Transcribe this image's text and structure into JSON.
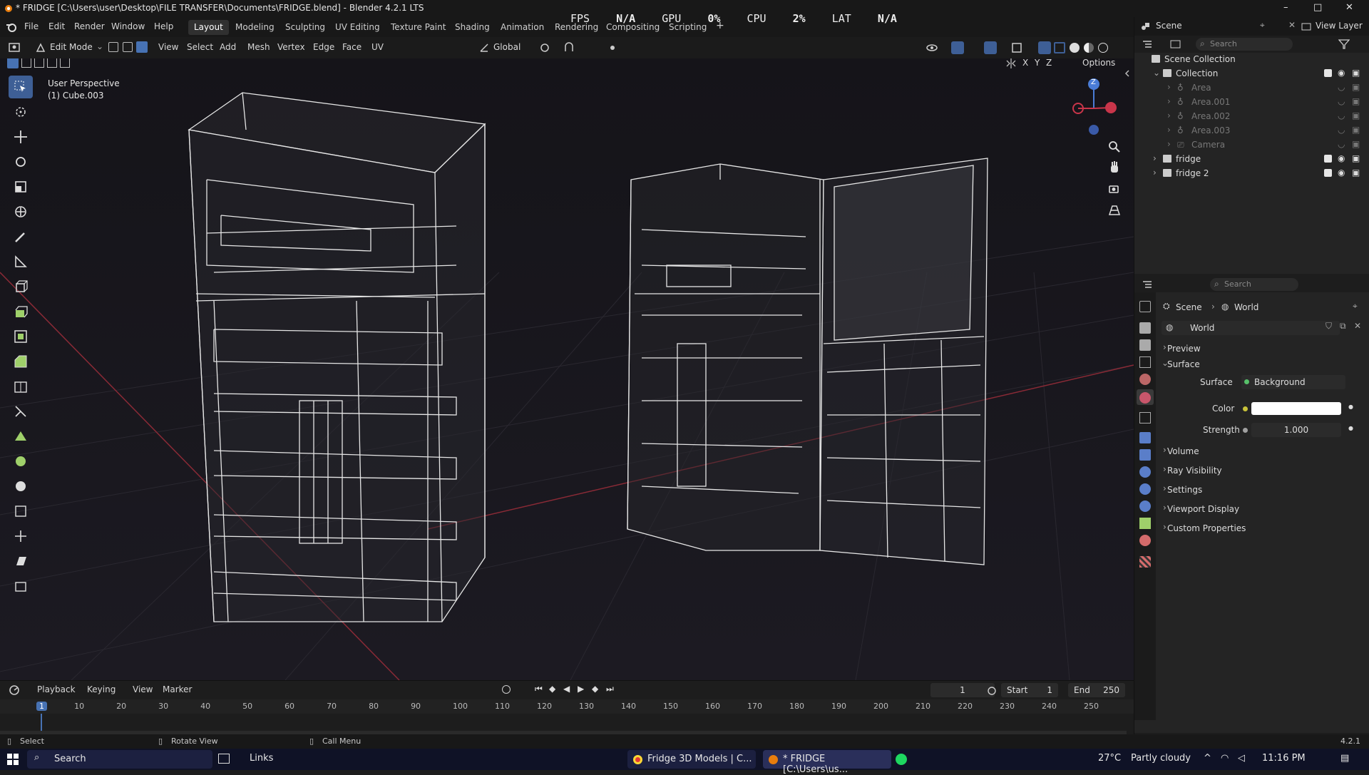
{
  "window": {
    "title": "* FRIDGE [C:\\Users\\user\\Desktop\\FILE TRANSFER\\Documents\\FRIDGE.blend] - Blender 4.2.1 LTS",
    "minimize": "–",
    "maximize": "□",
    "close": "✕"
  },
  "menus": [
    "File",
    "Edit",
    "Render",
    "Window",
    "Help"
  ],
  "workspaces": [
    {
      "label": "Layout",
      "active": true
    },
    {
      "label": "Modeling"
    },
    {
      "label": "Sculpting"
    },
    {
      "label": "UV Editing"
    },
    {
      "label": "Texture Paint"
    },
    {
      "label": "Shading"
    },
    {
      "label": "Animation"
    },
    {
      "label": "Rendering"
    },
    {
      "label": "Compositing"
    },
    {
      "label": "Scripting"
    }
  ],
  "add_workspace": "+",
  "stats": {
    "fps_label": "FPS",
    "fps": "N/A",
    "gpu_label": "GPU",
    "gpu": "0%",
    "cpu_label": "CPU",
    "cpu": "2%",
    "lat_label": "LAT",
    "lat": "N/A"
  },
  "scene_selector": {
    "label": "Scene",
    "view_layer": "View Layer"
  },
  "viewport_header": {
    "mode": "Edit Mode",
    "menus": [
      "View",
      "Select",
      "Add",
      "Mesh",
      "Vertex",
      "Edge",
      "Face",
      "UV"
    ],
    "transform": "Global",
    "axes": [
      "X",
      "Y",
      "Z"
    ],
    "options": "Options"
  },
  "viewport": {
    "perspective": "User Perspective",
    "object": "(1) Cube.003",
    "gizmo_z": "Z"
  },
  "outliner": {
    "search_placeholder": "Search",
    "root": "Scene Collection",
    "collection": "Collection",
    "items": [
      "Area",
      "Area.001",
      "Area.002",
      "Area.003",
      "Camera"
    ],
    "objects": [
      "fridge",
      "fridge 2"
    ]
  },
  "properties": {
    "search_placeholder": "Search",
    "breadcrumb": [
      "Scene",
      "World"
    ],
    "world_name": "World",
    "panels": {
      "preview": "Preview",
      "surface": "Surface",
      "volume": "Volume",
      "ray_visibility": "Ray Visibility",
      "settings": "Settings",
      "viewport_display": "Viewport Display",
      "custom_properties": "Custom Properties"
    },
    "surface_label": "Surface",
    "surface_value": "Background",
    "color_label": "Color",
    "color_value": "#ffffff",
    "strength_label": "Strength",
    "strength_value": "1.000"
  },
  "timeline": {
    "menus": [
      "Playback",
      "Keying",
      "View",
      "Marker"
    ],
    "current_frame": "1",
    "start_label": "Start",
    "start": "1",
    "end_label": "End",
    "end": "250",
    "ruler": [
      "1",
      "10",
      "20",
      "30",
      "40",
      "50",
      "60",
      "70",
      "80",
      "90",
      "100",
      "110",
      "120",
      "130",
      "140",
      "150",
      "160",
      "170",
      "180",
      "190",
      "200",
      "210",
      "220",
      "230",
      "240",
      "250"
    ]
  },
  "statusbar": {
    "select": "Select",
    "rotate": "Rotate View",
    "menu": "Call Menu",
    "version": "4.2.1"
  },
  "taskbar": {
    "search": "Search",
    "links": "Links",
    "app1": "Fridge 3D Models | C...",
    "app2": "* FRIDGE [C:\\Users\\us...",
    "weather_temp": "27°C",
    "weather": "Partly cloudy",
    "time": "11:16 PM"
  },
  "colors": {
    "accent": "#3e5f96",
    "active_tab": "#303030",
    "frame_marker": "#4772b3",
    "wire": "#e6e6e6"
  }
}
